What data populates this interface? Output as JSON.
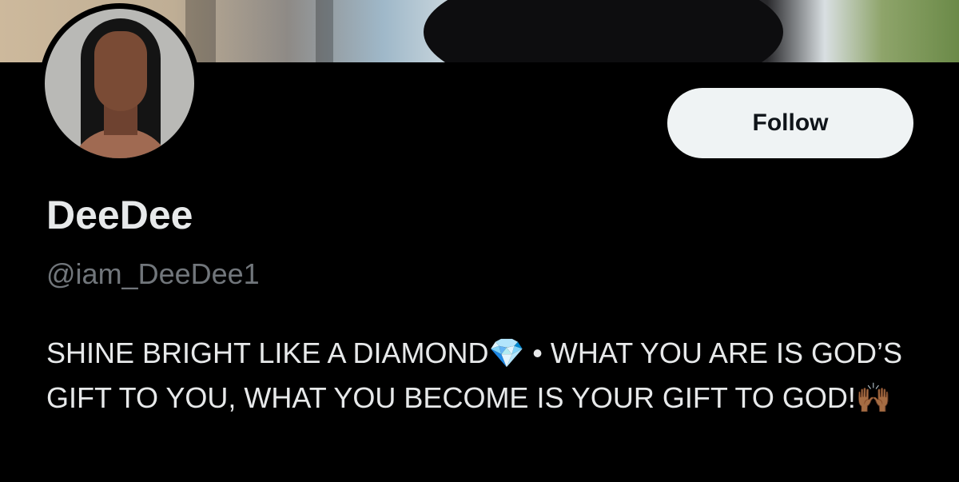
{
  "profile": {
    "display_name": "DeeDee",
    "handle": "@iam_DeeDee1",
    "follow_label": "Follow",
    "bio": "SHINE BRIGHT LIKE A DIAMOND💎 • WHAT YOU ARE IS GOD’S GIFT TO YOU, WHAT YOU BECOME IS YOUR GIFT TO GOD!🙌🏾"
  },
  "colors": {
    "background": "#000000",
    "text": "#e7e9ea",
    "secondary_text": "#71767b",
    "button_bg": "#eff3f4",
    "button_text": "#0f1419"
  }
}
